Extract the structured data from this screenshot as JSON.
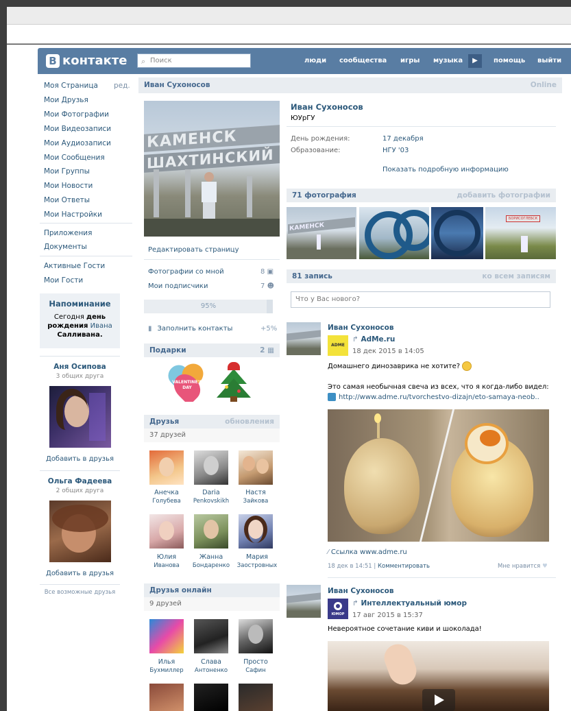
{
  "header": {
    "logo_text": "контакте",
    "logo_letter": "B",
    "search_placeholder": "Поиск",
    "nav": [
      "люди",
      "сообщества",
      "игры",
      "музыка",
      "помощь",
      "выйти"
    ]
  },
  "left_menu": {
    "items": [
      "Моя Страница",
      "Мои Друзья",
      "Мои Фотографии",
      "Мои Видеозаписи",
      "Мои Аудиозаписи",
      "Мои Сообщения",
      "Мои Группы",
      "Мои Новости",
      "Мои Ответы",
      "Мои Настройки"
    ],
    "edit_label": "ред.",
    "items2": [
      "Приложения",
      "Документы"
    ],
    "items3": [
      "Активные Гости",
      "Мои Гости"
    ]
  },
  "reminder": {
    "title": "Напоминание",
    "line1": "Сегодня",
    "line1b": "день",
    "line2": "рождения",
    "name1": "Ивана",
    "name2": "Салливана."
  },
  "suggestions": [
    {
      "name": "Аня Осипова",
      "sub": "3 общих друга",
      "btn": "Добавить в друзья"
    },
    {
      "name": "Ольга Фадеева",
      "sub": "2 общих друга",
      "btn": "Добавить в друзья"
    }
  ],
  "all_friends_link": "Все возможные друзья",
  "profile": {
    "name_header": "Иван Сухоносов",
    "status": "Online",
    "name": "Иван Сухоносов",
    "sub": "ЮУрГУ",
    "birthday_label": "День рождения:",
    "birthday_value": "17 декабря",
    "education_label": "Образование:",
    "education_value": "НГУ '03",
    "more_info": "Показать подробную информацию"
  },
  "avatar_sign": {
    "line1": "КАМЕНСК",
    "line2": "ШАХТИНСКИЙ"
  },
  "mid_column": {
    "edit_page": "Редактировать страницу",
    "photos_with_me": "Фотографии со мной",
    "photos_with_me_count": "8",
    "subscribers": "Мои подписчики",
    "subscribers_count": "7",
    "progress_label": "95%",
    "progress_value": 0.95,
    "fill_contacts": "Заполнить контакты",
    "fill_contacts_bonus": "+5%",
    "gifts_title": "Подарки",
    "gifts_count": "2",
    "gift_text": [
      "VALENTINE'S",
      "DAY"
    ],
    "friends_title": "Друзья",
    "friends_updates": "обновления",
    "friends_count": "37 друзей",
    "friends": [
      {
        "first": "Анечка",
        "last": "Голубева"
      },
      {
        "first": "Daria",
        "last": "Penkovskikh"
      },
      {
        "first": "Настя",
        "last": "Зайкова"
      },
      {
        "first": "Юлия",
        "last": "Иванова"
      },
      {
        "first": "Жанна",
        "last": "Бондаренко"
      },
      {
        "first": "Мария",
        "last": "Заостровных"
      }
    ],
    "online_title": "Друзья онлайн",
    "online_count": "9 друзей",
    "online_friends": [
      {
        "first": "Илья",
        "last": "Бухмиллер"
      },
      {
        "first": "Слава",
        "last": "Антоненко"
      },
      {
        "first": "Просто",
        "last": "Сафин"
      }
    ]
  },
  "photos": {
    "title": "71 фотография",
    "add": "добавить фотографии",
    "thumb_sign": "БОРИСОГЛЕБСК",
    "thumb_sign2": "КАМЕНСК"
  },
  "wall": {
    "title": "81 запись",
    "all": "ко всем записям",
    "input_placeholder": "Что у Вас нового?"
  },
  "posts": [
    {
      "author": "Иван Сухоносов",
      "source": "AdMe.ru",
      "source_logo": "ADME",
      "date": "18 дек 2015 в 14:05",
      "text1": "Домашнего динозаврика не хотите?",
      "text2": "Это самая необычная свеча из всех, что я когда-либо видел:",
      "link": "http://www.adme.ru/tvorchestvo-dizajn/eto-samaya-neob..",
      "link_label": "Ссылка www.adme.ru",
      "meta_date": "18 дек в 14:51",
      "comment": "Комментировать",
      "like": "Мне нравится"
    },
    {
      "author": "Иван Сухоносов",
      "source": "Интеллектуальный юмор",
      "source_logo": "ЮМОР",
      "date": "17 авг 2015 в 15:37",
      "text1": "Невероятное сочетание киви и шоколада!"
    }
  ],
  "colors": {
    "brand": "#597da3",
    "link": "#2b587a",
    "header_bg": "#e9edf1"
  }
}
